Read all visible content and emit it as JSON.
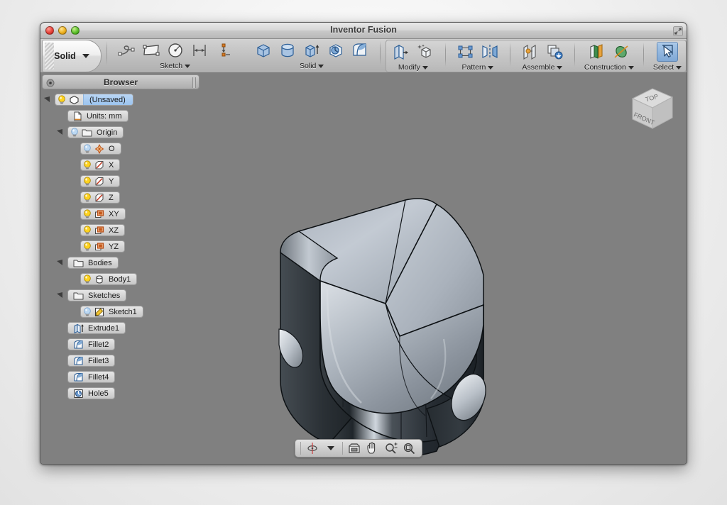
{
  "window": {
    "title": "Inventor Fusion",
    "controls": [
      "close",
      "minimize",
      "zoom"
    ],
    "resize_icon": "resize-corner-icon"
  },
  "ribbon": {
    "workspace": {
      "label": "Solid",
      "icon": "chevron-down-icon"
    },
    "groups": [
      {
        "label": "Sketch",
        "caret": "chevron-down-icon",
        "tools": [
          {
            "name": "sketch-line-icon",
            "title": "Line"
          },
          {
            "name": "sketch-rectangle-icon",
            "title": "Rectangle"
          },
          {
            "name": "sketch-circle-icon",
            "title": "Circle"
          },
          {
            "name": "sketch-dimension-icon",
            "title": "Dimension"
          },
          {
            "name": "sketch-constraint-icon",
            "title": "Constraint"
          }
        ]
      },
      {
        "label": "Solid",
        "caret": "chevron-down-icon",
        "tools": [
          {
            "name": "solid-box-icon",
            "title": "Box"
          },
          {
            "name": "solid-cylinder-icon",
            "title": "Cylinder"
          },
          {
            "name": "solid-extrude-icon",
            "title": "Extrude"
          },
          {
            "name": "solid-revolve-icon",
            "title": "Revolve"
          },
          {
            "name": "solid-fillet-icon",
            "title": "Fillet"
          }
        ]
      },
      {
        "label": "Modify",
        "caret": "chevron-down-icon",
        "tools": [
          {
            "name": "modify-press-pull-icon",
            "title": "Press Pull"
          },
          {
            "name": "modify-move-icon",
            "title": "Move"
          }
        ]
      },
      {
        "label": "Pattern",
        "caret": "chevron-down-icon",
        "tools": [
          {
            "name": "pattern-rectangular-icon",
            "title": "Rectangular Pattern"
          },
          {
            "name": "pattern-mirror-icon",
            "title": "Mirror"
          }
        ]
      },
      {
        "label": "Assemble",
        "caret": "chevron-down-icon",
        "tools": [
          {
            "name": "assemble-joint-icon",
            "title": "Joint"
          },
          {
            "name": "assemble-insert-icon",
            "title": "Insert"
          }
        ]
      },
      {
        "label": "Construction",
        "caret": "chevron-down-icon",
        "tools": [
          {
            "name": "construction-plane-icon",
            "title": "Plane"
          },
          {
            "name": "construction-axis-icon",
            "title": "Axis"
          }
        ]
      },
      {
        "label": "Select",
        "caret": "chevron-down-icon",
        "tools": [
          {
            "name": "select-arrow-icon",
            "title": "Select",
            "active": true
          }
        ]
      }
    ]
  },
  "browser": {
    "header": {
      "title": "Browser",
      "gear_icon": "gear-icon",
      "grabber_icon": "panel-grabber-icon"
    },
    "nodes": [
      {
        "label": "(Unsaved)",
        "indent": 0,
        "twisty": "expanded",
        "bulb": "on",
        "icon": "document-body-icon",
        "selected": true
      },
      {
        "label": "Units: mm",
        "indent": 1,
        "twisty": "none",
        "bulb": "none",
        "icon": "units-document-icon",
        "selected": false
      },
      {
        "label": "Origin",
        "indent": 1,
        "twisty": "expanded",
        "bulb": "dim",
        "icon": "folder-icon",
        "selected": false
      },
      {
        "label": "O",
        "indent": 2,
        "twisty": "none",
        "bulb": "dim",
        "icon": "origin-point-icon",
        "selected": false
      },
      {
        "label": "X",
        "indent": 2,
        "twisty": "none",
        "bulb": "on",
        "icon": "axis-icon",
        "selected": false
      },
      {
        "label": "Y",
        "indent": 2,
        "twisty": "none",
        "bulb": "on",
        "icon": "axis-icon",
        "selected": false
      },
      {
        "label": "Z",
        "indent": 2,
        "twisty": "none",
        "bulb": "on",
        "icon": "axis-icon",
        "selected": false
      },
      {
        "label": "XY",
        "indent": 2,
        "twisty": "none",
        "bulb": "on",
        "icon": "plane-icon",
        "selected": false
      },
      {
        "label": "XZ",
        "indent": 2,
        "twisty": "none",
        "bulb": "on",
        "icon": "plane-icon",
        "selected": false
      },
      {
        "label": "YZ",
        "indent": 2,
        "twisty": "none",
        "bulb": "on",
        "icon": "plane-icon",
        "selected": false
      },
      {
        "label": "Bodies",
        "indent": 1,
        "twisty": "expanded",
        "bulb": "none",
        "icon": "folder-icon",
        "selected": false
      },
      {
        "label": "Body1",
        "indent": 2,
        "twisty": "none",
        "bulb": "on",
        "icon": "body-icon",
        "selected": false
      },
      {
        "label": "Sketches",
        "indent": 1,
        "twisty": "expanded",
        "bulb": "none",
        "icon": "folder-icon",
        "selected": false
      },
      {
        "label": "Sketch1",
        "indent": 2,
        "twisty": "none",
        "bulb": "dim",
        "icon": "sketch-icon",
        "selected": false
      },
      {
        "label": "Extrude1",
        "indent": 1,
        "twisty": "none",
        "bulb": "none",
        "icon": "feature-extrude-icon",
        "selected": false
      },
      {
        "label": "Fillet2",
        "indent": 1,
        "twisty": "none",
        "bulb": "none",
        "icon": "feature-fillet-icon",
        "selected": false
      },
      {
        "label": "Fillet3",
        "indent": 1,
        "twisty": "none",
        "bulb": "none",
        "icon": "feature-fillet-icon",
        "selected": false
      },
      {
        "label": "Fillet4",
        "indent": 1,
        "twisty": "none",
        "bulb": "none",
        "icon": "feature-fillet-icon",
        "selected": false
      },
      {
        "label": "Hole5",
        "indent": 1,
        "twisty": "none",
        "bulb": "none",
        "icon": "feature-hole-icon",
        "selected": false
      }
    ]
  },
  "viewcube": {
    "top_face_label": "TOP",
    "front_face_label": "FRONT"
  },
  "navbar": {
    "tools": [
      {
        "name": "orbit-icon",
        "title": "Orbit"
      },
      {
        "name": "chevron-down-icon",
        "title": "Orbit options"
      },
      {
        "name": "look-at-icon",
        "title": "Look At"
      },
      {
        "name": "pan-hand-icon",
        "title": "Pan"
      },
      {
        "name": "zoom-inout-icon",
        "title": "Zoom"
      },
      {
        "name": "zoom-window-icon",
        "title": "Zoom Window"
      }
    ]
  },
  "canvas": {
    "background_color": "#808080",
    "model": {
      "name": "Body1",
      "description": "Filleted solid block with two side hole cutouts",
      "top_face_color": "#b7bec7",
      "side_face_color": "#2e3338",
      "edge_color": "#101418"
    }
  },
  "colors": {
    "accent": "#7fa8d6",
    "selection": "#9cc4ef",
    "canvas": "#808080",
    "chrome": "#c0c0c0"
  }
}
